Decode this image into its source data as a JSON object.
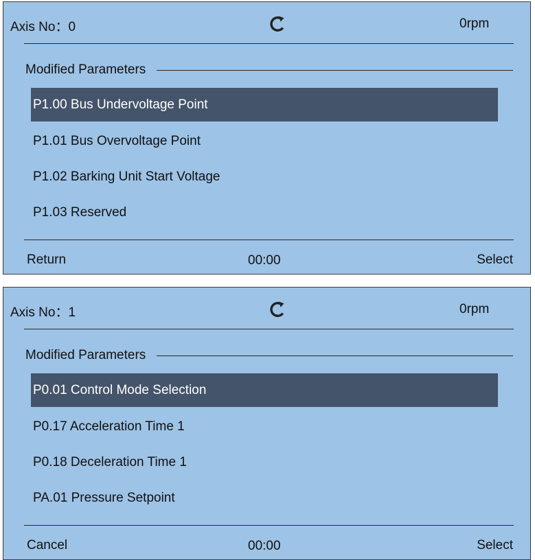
{
  "panels": [
    {
      "axis_label": "Axis No：",
      "axis_value": "0",
      "speed": "0rpm",
      "refresh_icon": "refresh-icon",
      "section_title": "Modified Parameters",
      "items": [
        {
          "label": "P1.00 Bus Undervoltage Point",
          "selected": true
        },
        {
          "label": "P1.01 Bus Overvoltage Point",
          "selected": false
        },
        {
          "label": "P1.02 Barking Unit Start Voltage",
          "selected": false
        },
        {
          "label": "P1.03 Reserved",
          "selected": false
        }
      ],
      "footer": {
        "left": "Return",
        "center": "00:00",
        "right": "Select"
      }
    },
    {
      "axis_label": "Axis No：",
      "axis_value": "1",
      "speed": "0rpm",
      "refresh_icon": "refresh-icon",
      "section_title": "Modified Parameters",
      "items": [
        {
          "label": "P0.01 Control Mode Selection",
          "selected": true
        },
        {
          "label": "P0.17 Acceleration Time 1",
          "selected": false
        },
        {
          "label": "P0.18 Deceleration Time 1",
          "selected": false
        },
        {
          "label": "PA.01 Pressure Setpoint",
          "selected": false
        }
      ],
      "footer": {
        "left": "Cancel",
        "center": "00:00",
        "right": "Select"
      }
    }
  ],
  "colors": {
    "panel_bg": "#9dc3e6",
    "selected_bg": "#44546a",
    "selected_text": "#ffffff",
    "text": "#111111",
    "rule": "#2a2a2a"
  }
}
